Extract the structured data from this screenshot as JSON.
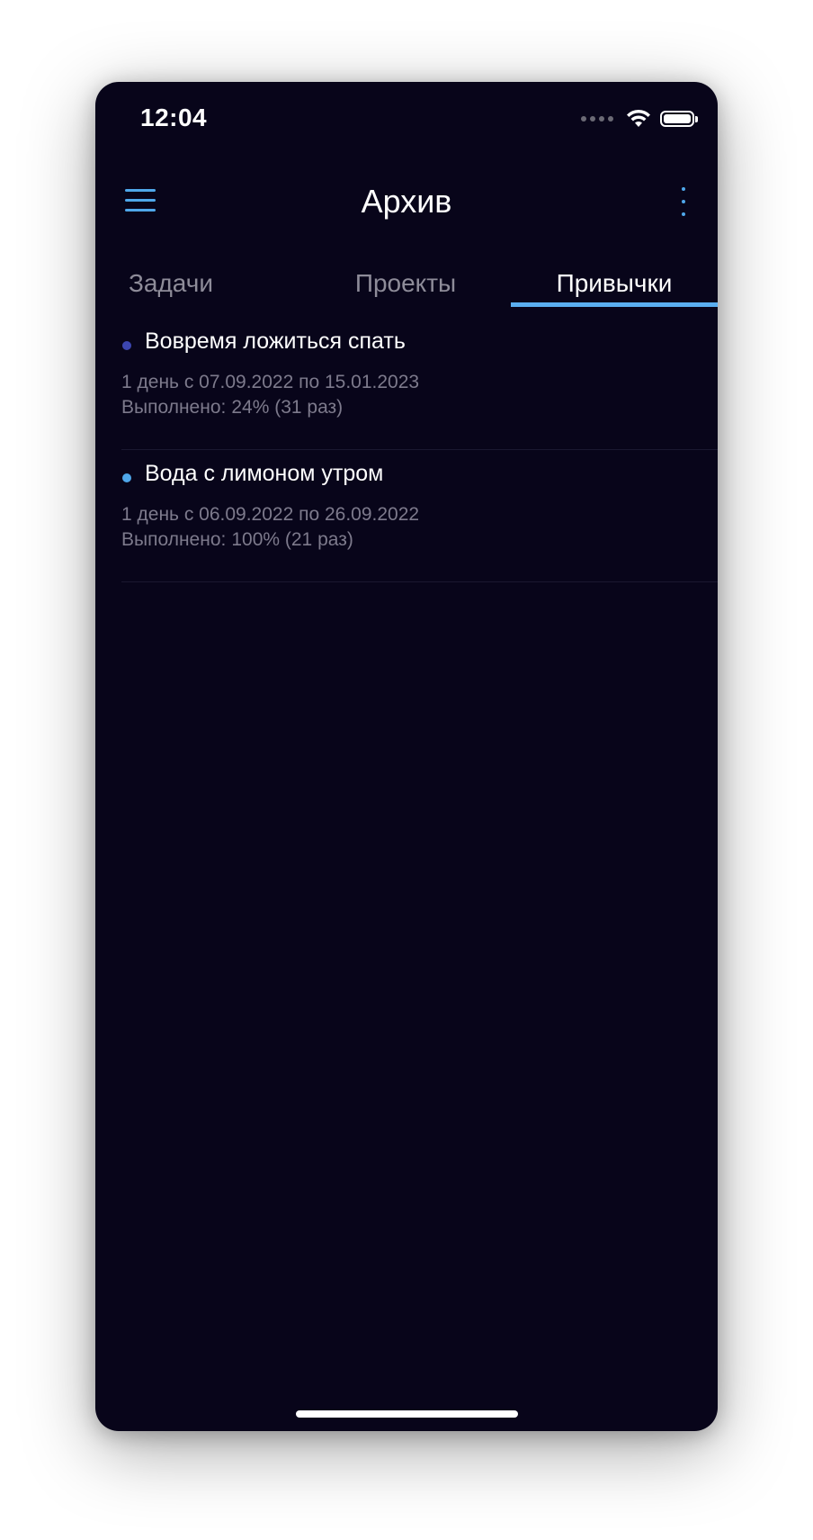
{
  "status_bar": {
    "time": "12:04"
  },
  "header": {
    "title": "Архив",
    "menu_icon": "hamburger-icon",
    "more_icon": "vertical-dots-icon"
  },
  "tabs": [
    {
      "label": "Задачи",
      "active": false
    },
    {
      "label": "Проекты",
      "active": false
    },
    {
      "label": "Привычки",
      "active": true
    }
  ],
  "habits": [
    {
      "name": "Вовремя ложиться спать",
      "color": "#3c46b0",
      "period": "1 день с 07.09.2022 по 15.01.2023",
      "progress_label": "Выполнено:",
      "progress_value": "24% (31 раз)"
    },
    {
      "name": "Вода с лимоном утром",
      "color": "#4fa7ea",
      "period": "1 день с 06.09.2022 по 26.09.2022",
      "progress_label": "Выполнено:",
      "progress_value": "100% (21 раз)"
    }
  ],
  "colors": {
    "background": "#08051a",
    "accent": "#4fa7ea",
    "inactive_tab": "#8e8c99",
    "secondary_text": "#7d7a8c"
  }
}
